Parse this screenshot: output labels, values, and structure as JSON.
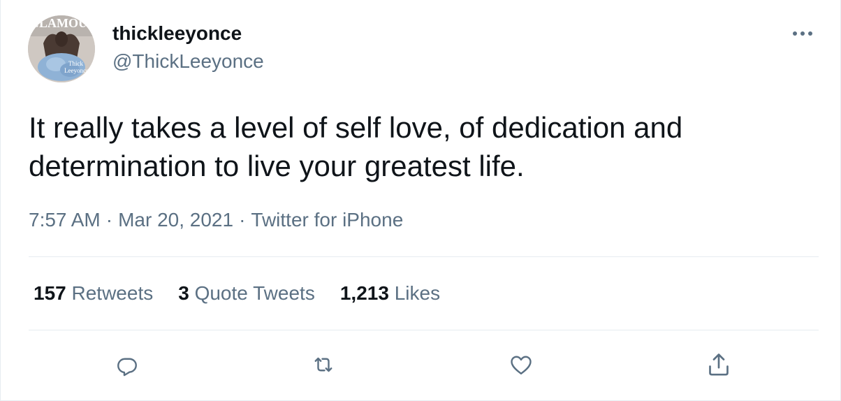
{
  "tweet": {
    "display_name": "thickleeyonce",
    "handle": "@ThickLeeyonce",
    "text_line1": "It really takes a level of self love, of dedication and",
    "text_line2": "determination to live your greatest life.",
    "time": "7:57 AM",
    "date": "Mar 20, 2021",
    "source": "Twitter for iPhone",
    "separator": "·"
  },
  "avatar": {
    "magazine_text": "GLAMOUR",
    "caption_line1": "Thick",
    "caption_line2": "Leeyonce"
  },
  "stats": {
    "retweets_count": "157",
    "retweets_label": "Retweets",
    "quotes_count": "3",
    "quotes_label": "Quote Tweets",
    "likes_count": "1,213",
    "likes_label": "Likes"
  },
  "actions": {
    "reply_icon": "reply-icon",
    "retweet_icon": "retweet-icon",
    "like_icon": "heart-icon",
    "share_icon": "share-icon"
  },
  "colors": {
    "text_primary": "#0f1419",
    "text_secondary": "#5b7083",
    "divider": "#e6ecf0"
  }
}
